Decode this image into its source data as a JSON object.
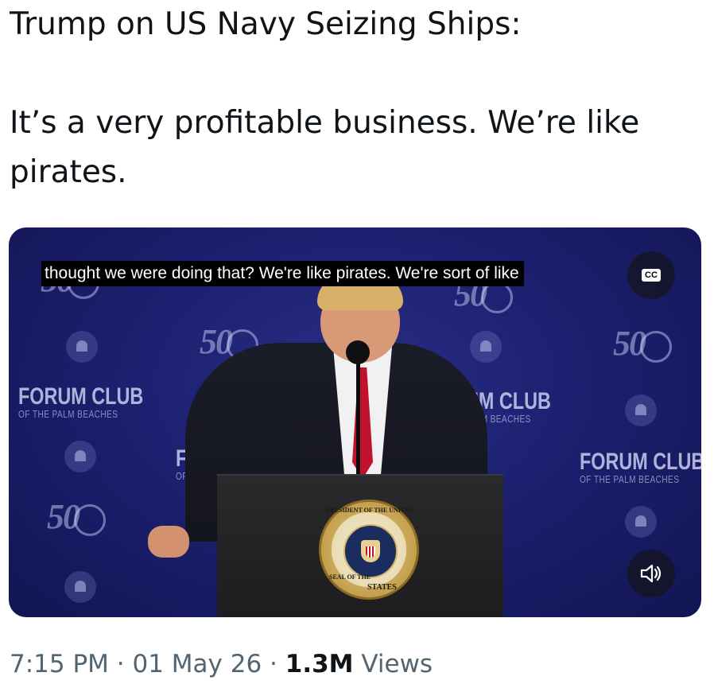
{
  "tweet": {
    "line1": "Trump on US Navy Seizing Ships:",
    "line2": "It’s a very profitable business. We’re like",
    "line3": "pirates."
  },
  "video": {
    "caption": "thought we were doing that? We're like pirates. We're sort of like",
    "cc_label": "CC",
    "backdrop": {
      "forum_left_big": "FORUM CLUB",
      "forum_left_small": "OF THE PALM BEACHES",
      "forum_center_big": "UM CLUB",
      "forum_center_small": "PALM BEACHES",
      "forum_mid_big": "FOR",
      "forum_mid_small": "OF TI",
      "forum_right_big": "FORUM CLUB",
      "forum_right_small": "OF THE PALM BEACHES",
      "logo_50": "50"
    },
    "seal": {
      "top": "PRESIDENT OF THE UNITED",
      "right": "STATES",
      "left": "SEAL OF THE"
    }
  },
  "meta": {
    "time": "7:15 PM",
    "separator1": " · ",
    "date": "01 May 26",
    "separator2": " · ",
    "views_count": "1.3M",
    "views_label": " Views"
  },
  "icons": {
    "cc": "closed-captions-icon",
    "volume": "speaker-icon"
  },
  "colors": {
    "text_primary": "#0f1419",
    "text_secondary": "#536471",
    "video_bg": "#1c2070"
  }
}
